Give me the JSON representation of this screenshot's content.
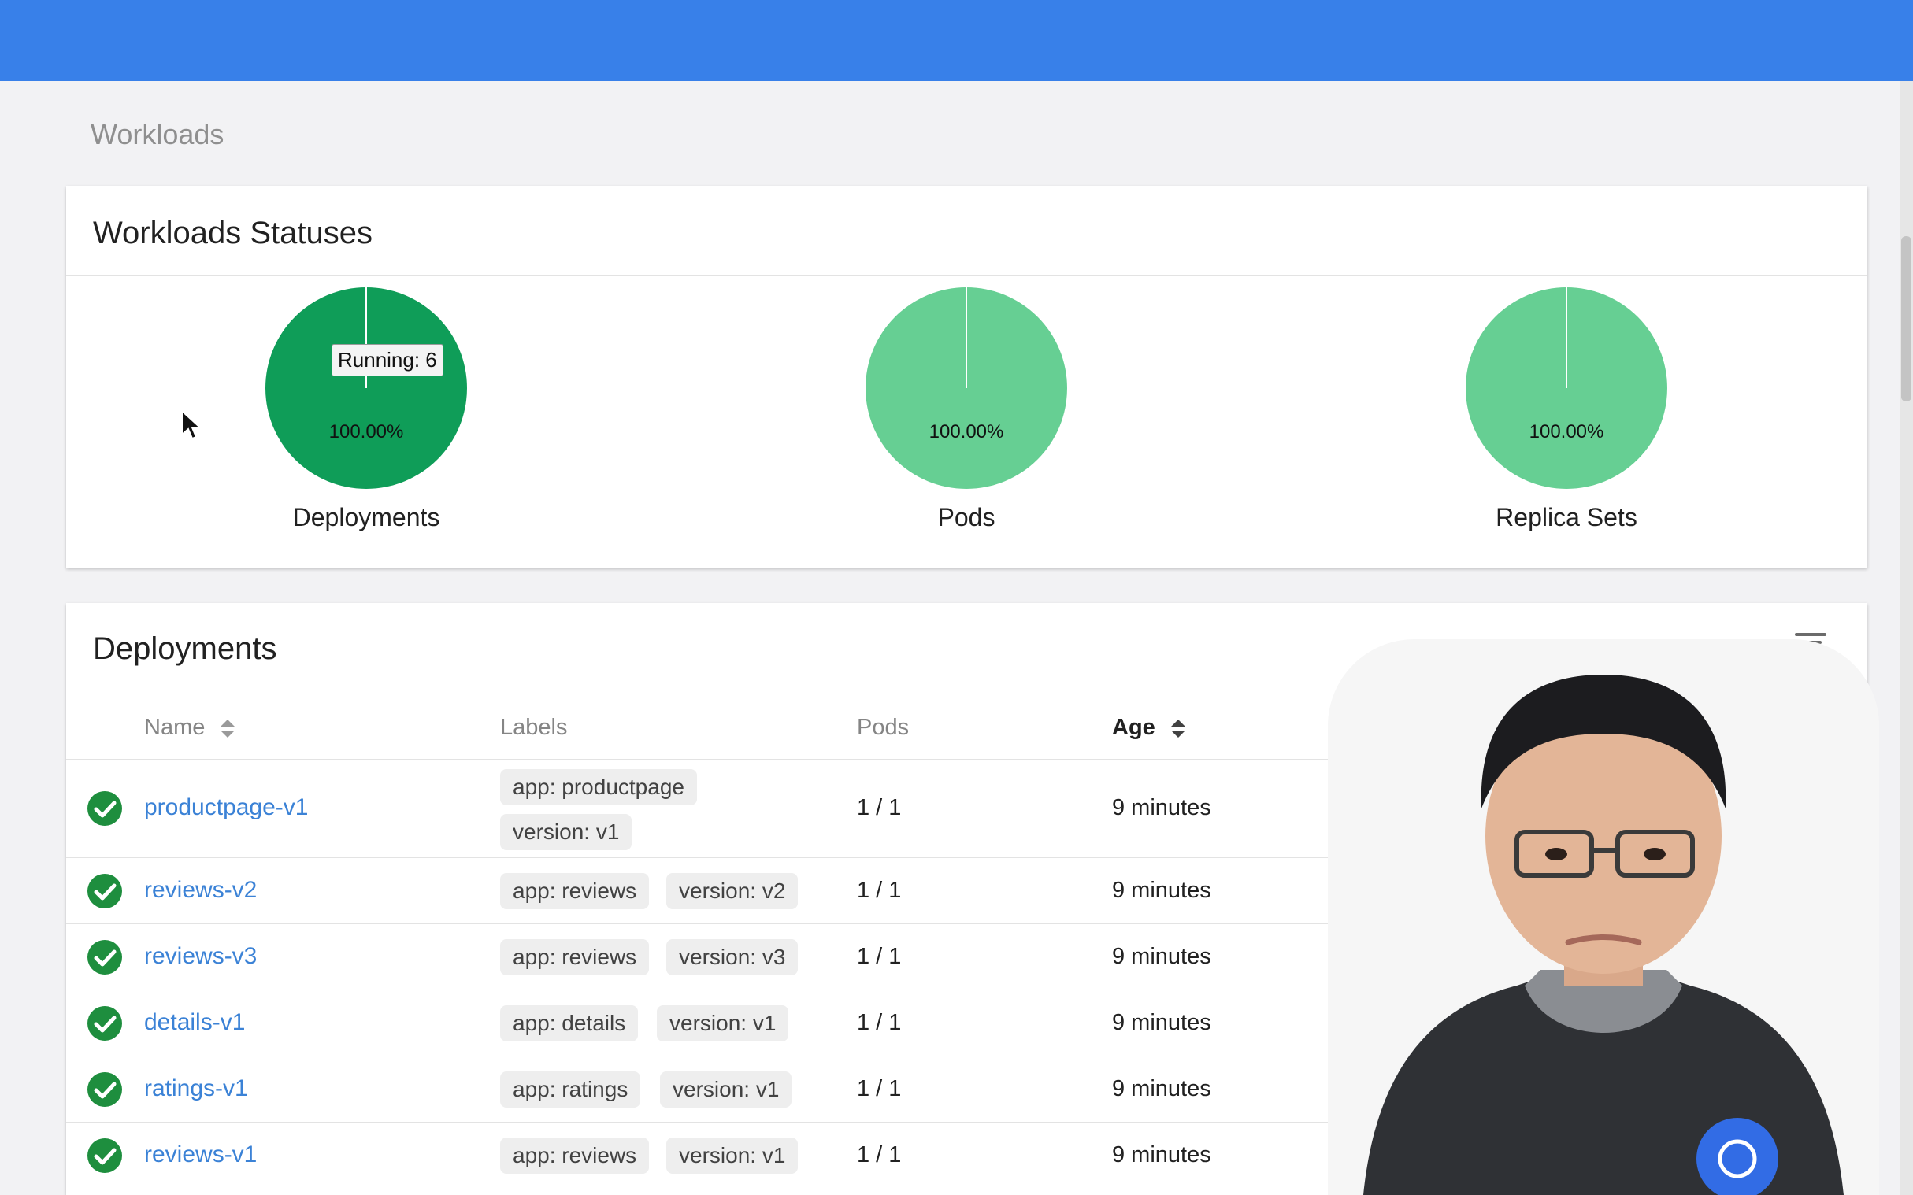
{
  "breadcrumb": "Workloads",
  "statuses": {
    "title": "Workloads Statuses",
    "pies": [
      {
        "name": "Deployments",
        "percent_label": "100.00%",
        "running_fraction": 1.0,
        "color": "#0f9d58",
        "tooltip": "Running: 6"
      },
      {
        "name": "Pods",
        "percent_label": "100.00%",
        "running_fraction": 1.0,
        "color": "#66cf93"
      },
      {
        "name": "Replica Sets",
        "percent_label": "100.00%",
        "running_fraction": 1.0,
        "color": "#66cf93"
      }
    ]
  },
  "deployments": {
    "title": "Deployments",
    "columns": [
      "Name",
      "Labels",
      "Pods",
      "Age"
    ],
    "rows": [
      {
        "name": "productpage-v1",
        "labels": [
          "app: productpage",
          "version: v1"
        ],
        "pods": "1 / 1",
        "age": "9 minutes"
      },
      {
        "name": "reviews-v2",
        "labels": [
          "app: reviews",
          "version: v2"
        ],
        "pods": "1 / 1",
        "age": "9 minutes"
      },
      {
        "name": "reviews-v3",
        "labels": [
          "app: reviews",
          "version: v3"
        ],
        "pods": "1 / 1",
        "age": "9 minutes"
      },
      {
        "name": "details-v1",
        "labels": [
          "app: details",
          "version: v1"
        ],
        "pods": "1 / 1",
        "age": "9 minutes"
      },
      {
        "name": "ratings-v1",
        "labels": [
          "app: ratings",
          "version: v1"
        ],
        "pods": "1 / 1",
        "age": "9 minutes"
      },
      {
        "name": "reviews-v1",
        "labels": [
          "app: reviews",
          "version: v1"
        ],
        "pods": "1 / 1",
        "age": "9 minutes"
      }
    ]
  },
  "colors": {
    "topbar": "#3880e9",
    "status_ok": "#1e8e3e",
    "link": "#3b82d6",
    "deployments_pie": "#0f9d58",
    "pods_pie": "#66cf93",
    "replicasets_pie": "#66cf93"
  },
  "icons": [
    "check-circle-icon",
    "filter-icon",
    "sort-icon",
    "mouse-cursor-icon"
  ]
}
